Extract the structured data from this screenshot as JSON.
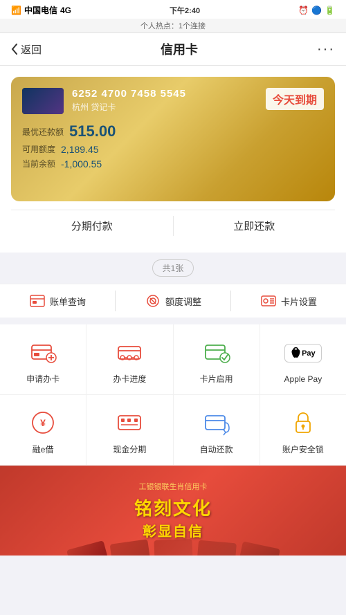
{
  "statusBar": {
    "carrier": "中国电信",
    "network": "4G",
    "time": "下午2:40",
    "hotspot": "个人热点：1个连接"
  },
  "navBar": {
    "back": "返回",
    "title": "信用卡",
    "more": "···"
  },
  "card": {
    "number": "6252 4700 7458 5545",
    "bank": "杭州 贷记卡",
    "dueLabel": "今天到期",
    "minPayLabel": "最优还款额",
    "minPayValue": "515.00",
    "availableLabel": "可用额度",
    "availableValue": "2,189.45",
    "balanceLabel": "当前余额",
    "balanceValue": "-1,000.55",
    "installmentBtn": "分期付款",
    "repayBtn": "立即还款"
  },
  "cardCount": "共1张",
  "quickActions": [
    {
      "id": "bill",
      "label": "账单查询"
    },
    {
      "id": "limit",
      "label": "额度调整"
    },
    {
      "id": "settings",
      "label": "卡片设置"
    }
  ],
  "gridMenu": {
    "row1": [
      {
        "id": "apply-card",
        "label": "申请办卡"
      },
      {
        "id": "card-progress",
        "label": "办卡进度"
      },
      {
        "id": "card-activate",
        "label": "卡片启用"
      },
      {
        "id": "apple-pay",
        "label": "Apple Pay"
      }
    ],
    "row2": [
      {
        "id": "rong-e-loan",
        "label": "融e借"
      },
      {
        "id": "installment",
        "label": "现金分期"
      },
      {
        "id": "auto-repay",
        "label": "自动还款"
      },
      {
        "id": "account-lock",
        "label": "账户安全锁"
      }
    ]
  },
  "banner": {
    "line1": "铭刻文化",
    "line2": "彰显自信",
    "sub": "工银银联生肖信用卡"
  }
}
